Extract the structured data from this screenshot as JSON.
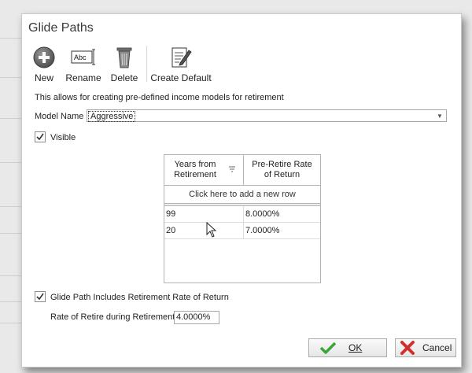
{
  "window": {
    "title": "Glide Paths"
  },
  "toolbar": {
    "new_label": "New",
    "rename_label": "Rename",
    "delete_label": "Delete",
    "create_default_label": "Create Default",
    "rename_icon_text": "Abc"
  },
  "description": "This allows for creating pre-defined income models for retirement",
  "model": {
    "label": "Model Name",
    "value": "Aggressive"
  },
  "visible": {
    "label": "Visible",
    "checked": true
  },
  "grid": {
    "columns": [
      "Years from Retirement",
      "Pre-Retire Rate of Return"
    ],
    "column_lines": [
      [
        "Years from",
        "Retirement"
      ],
      [
        "Pre-Retire Rate",
        "of Return"
      ]
    ],
    "add_row_text": "Click here to add a new row",
    "rows": [
      {
        "years": "99",
        "rate": "8.0000%"
      },
      {
        "years": "20",
        "rate": "7.0000%"
      }
    ]
  },
  "includes_retirement": {
    "label": "Glide Path Includes Retirement Rate of Return",
    "checked": true
  },
  "rate_retire": {
    "label": "Rate of Retire during Retirement",
    "value": "4.0000%"
  },
  "buttons": {
    "ok": "OK",
    "cancel": "Cancel"
  },
  "colors": {
    "ok_check": "#3aa637",
    "cancel_x": "#d0312d"
  }
}
